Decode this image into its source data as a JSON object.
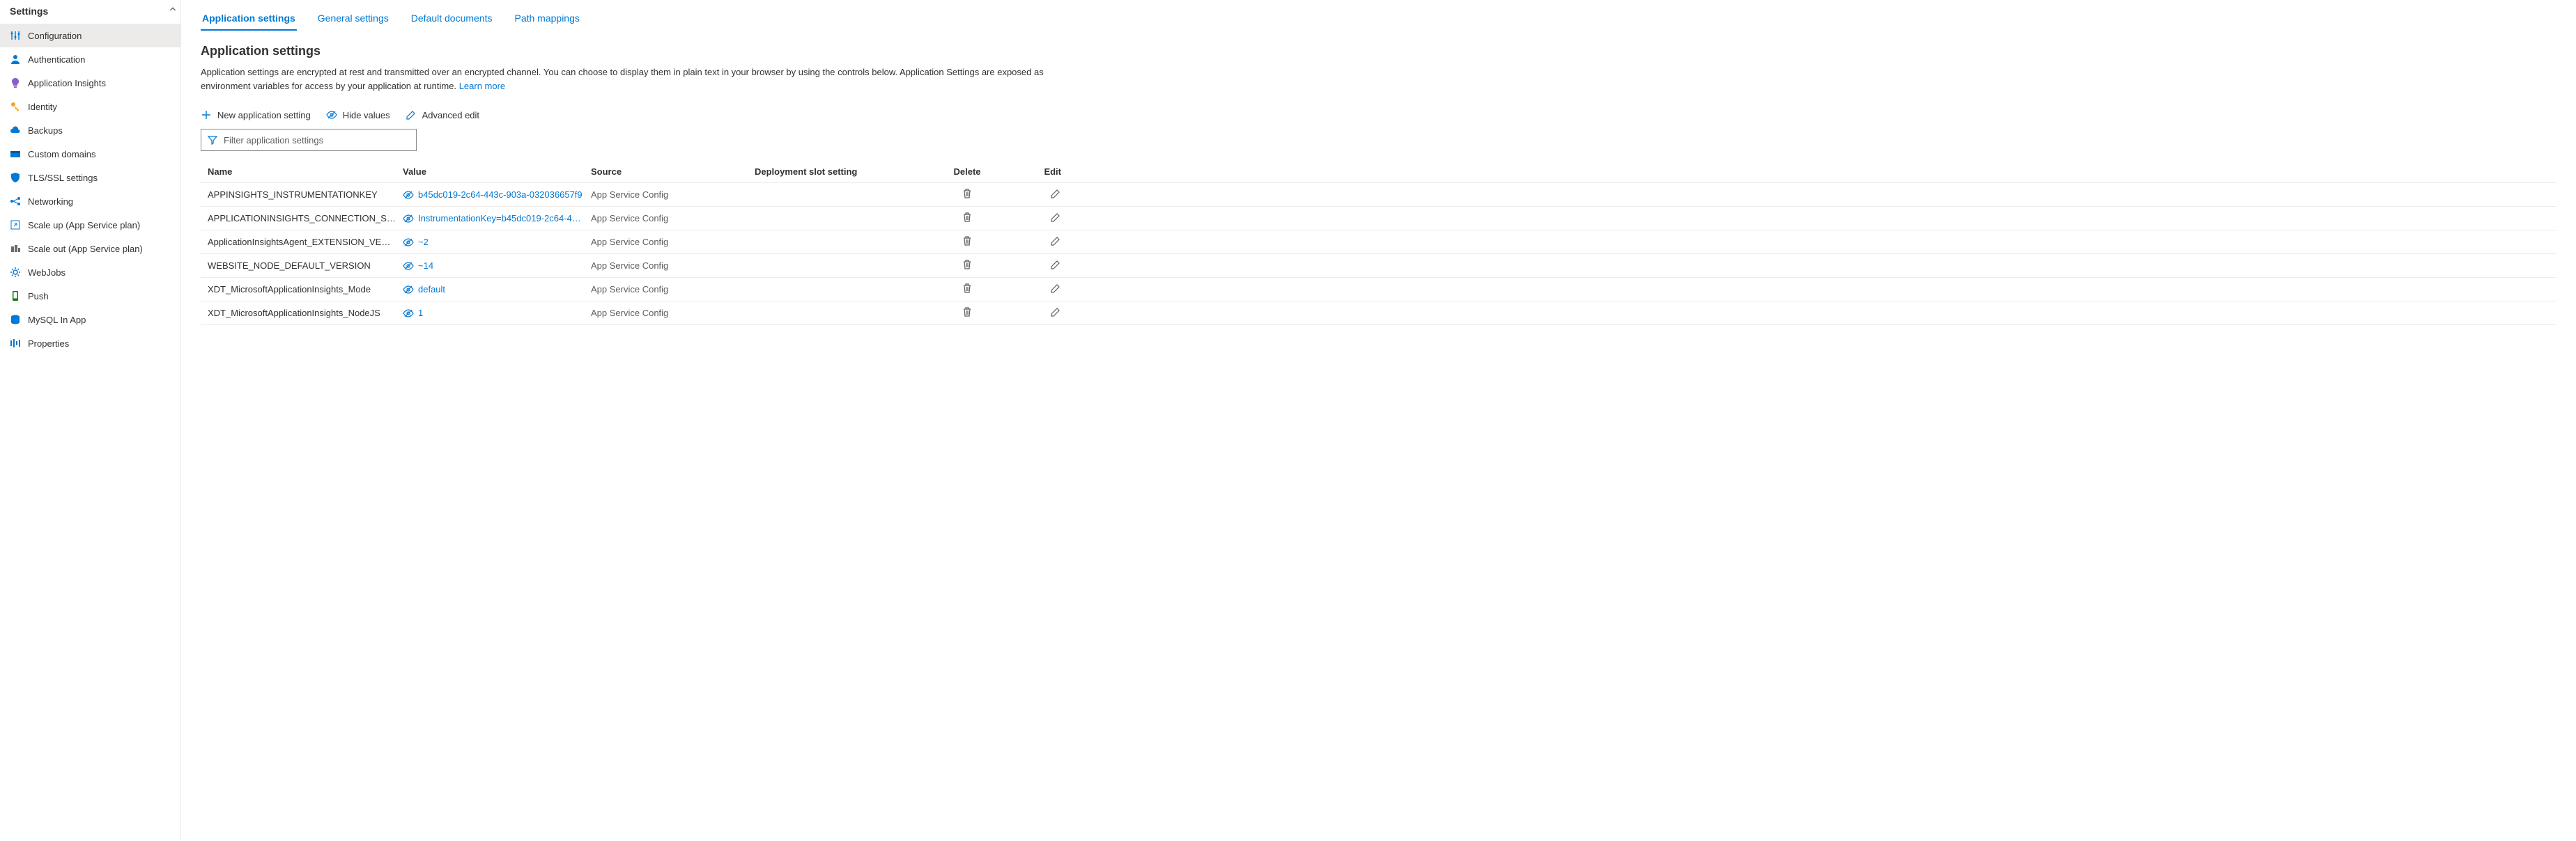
{
  "sidebar": {
    "title": "Settings",
    "items": [
      {
        "label": "Configuration",
        "icon": "sliders",
        "color": "#0078d4",
        "active": true
      },
      {
        "label": "Authentication",
        "icon": "person",
        "color": "#0078d4"
      },
      {
        "label": "Application Insights",
        "icon": "bulb",
        "color": "#8661c5"
      },
      {
        "label": "Identity",
        "icon": "key",
        "color": "#faa21b"
      },
      {
        "label": "Backups",
        "icon": "cloud",
        "color": "#0078d4"
      },
      {
        "label": "Custom domains",
        "icon": "domain",
        "color": "#0078d4"
      },
      {
        "label": "TLS/SSL settings",
        "icon": "shield",
        "color": "#0078d4"
      },
      {
        "label": "Networking",
        "icon": "network",
        "color": "#0078d4"
      },
      {
        "label": "Scale up (App Service plan)",
        "icon": "scaleup",
        "color": "#0078d4"
      },
      {
        "label": "Scale out (App Service plan)",
        "icon": "scaleout",
        "color": "#6b6b6b"
      },
      {
        "label": "WebJobs",
        "icon": "gear",
        "color": "#0078d4"
      },
      {
        "label": "Push",
        "icon": "push",
        "color": "#107c10"
      },
      {
        "label": "MySQL In App",
        "icon": "mysql",
        "color": "#0078d4"
      },
      {
        "label": "Properties",
        "icon": "properties",
        "color": "#0078d4"
      }
    ]
  },
  "tabs": [
    {
      "label": "Application settings",
      "active": true
    },
    {
      "label": "General settings"
    },
    {
      "label": "Default documents"
    },
    {
      "label": "Path mappings"
    }
  ],
  "section": {
    "title": "Application settings",
    "desc_prefix": "Application settings are encrypted at rest and transmitted over an encrypted channel. You can choose to display them in plain text in your browser by using the controls below. Application Settings are exposed as environment variables for access by your application at runtime. ",
    "learn_more": "Learn more"
  },
  "toolbar": {
    "new_label": "New application setting",
    "hide_label": "Hide values",
    "advanced_label": "Advanced edit"
  },
  "filter": {
    "placeholder": "Filter application settings"
  },
  "table": {
    "headers": {
      "name": "Name",
      "value": "Value",
      "source": "Source",
      "slot": "Deployment slot setting",
      "delete": "Delete",
      "edit": "Edit"
    },
    "rows": [
      {
        "name": "APPINSIGHTS_INSTRUMENTATIONKEY",
        "value": "b45dc019-2c64-443c-903a-032036657f9",
        "source": "App Service Config"
      },
      {
        "name": "APPLICATIONINSIGHTS_CONNECTION_STRING",
        "value": "InstrumentationKey=b45dc019-2c64-44…",
        "source": "App Service Config"
      },
      {
        "name": "ApplicationInsightsAgent_EXTENSION_VERSION",
        "value": "~2",
        "source": "App Service Config"
      },
      {
        "name": "WEBSITE_NODE_DEFAULT_VERSION",
        "value": "~14",
        "source": "App Service Config"
      },
      {
        "name": "XDT_MicrosoftApplicationInsights_Mode",
        "value": "default",
        "source": "App Service Config"
      },
      {
        "name": "XDT_MicrosoftApplicationInsights_NodeJS",
        "value": "1",
        "source": "App Service Config"
      }
    ]
  }
}
